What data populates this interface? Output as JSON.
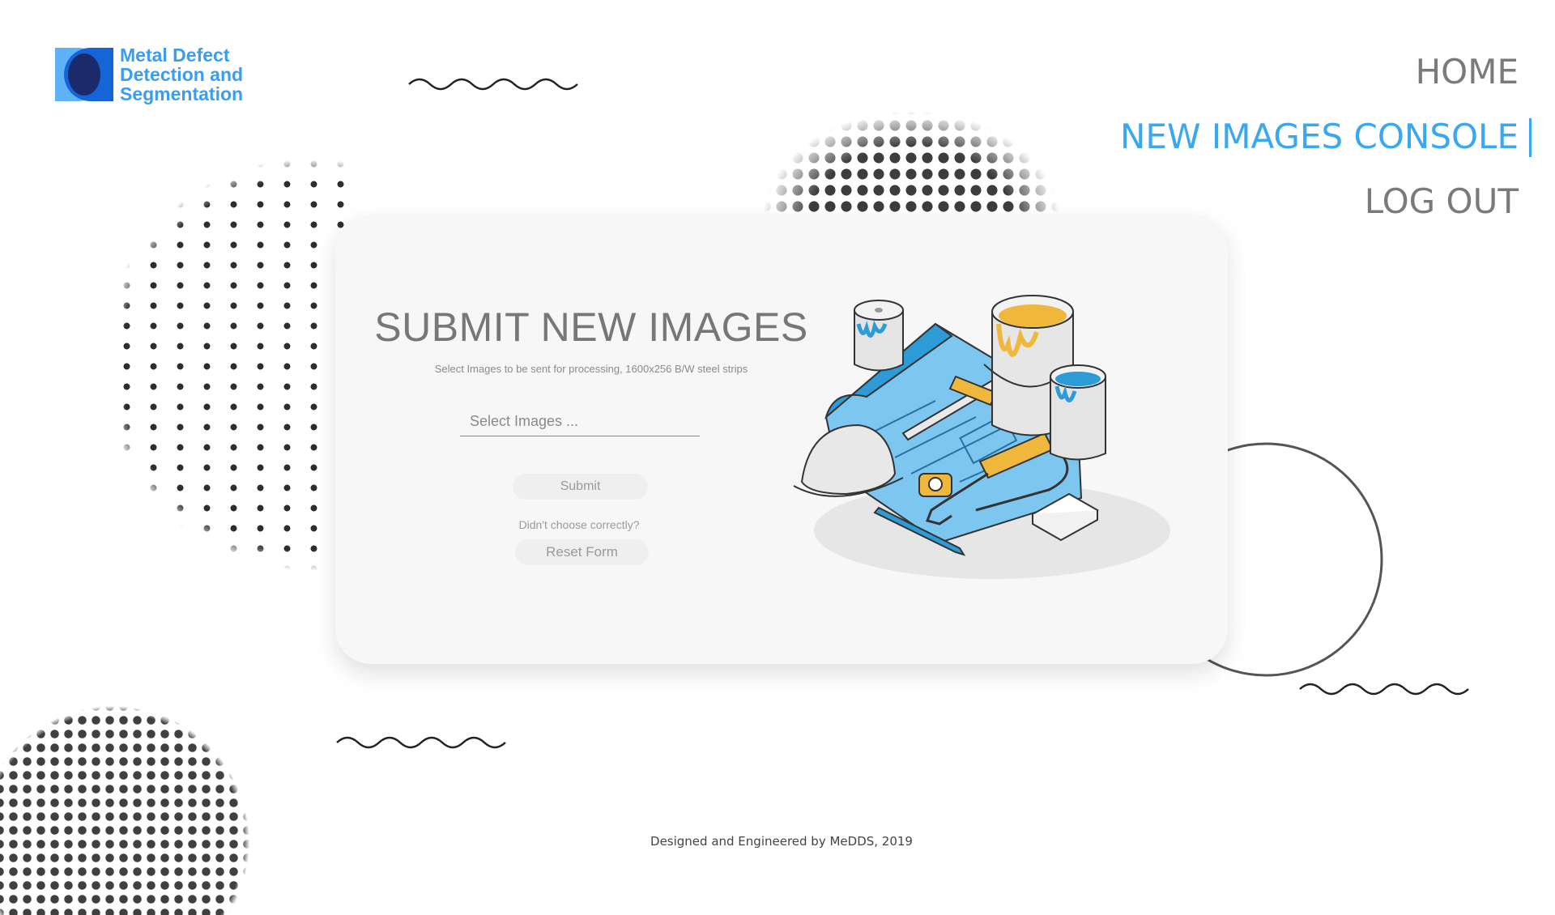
{
  "brand": {
    "name": "Metal Defect Detection and Segmentation",
    "line1": "Metal Defect",
    "line2": "Detection and",
    "line3": "Segmentation",
    "color": "#3b9df0"
  },
  "nav": {
    "items": [
      {
        "label": "HOME"
      },
      {
        "label": "NEW IMAGES CONSOLE",
        "active": true
      },
      {
        "label": "LOG OUT"
      }
    ],
    "accent": "#3aa8f0"
  },
  "form": {
    "title": "SUBMIT NEW IMAGES",
    "subtitle": "Select Images to be sent for processing, 1600x256 B/W steel strips",
    "file_placeholder": "Select Images ...",
    "submit_label": "Submit",
    "hint": "Didn't choose correctly?",
    "reset_label": "Reset Form"
  },
  "illustration": {
    "icon": "paint-cans-blueprint-illustration"
  },
  "footer": {
    "text": "Designed and Engineered by MeDDS, 2019"
  }
}
